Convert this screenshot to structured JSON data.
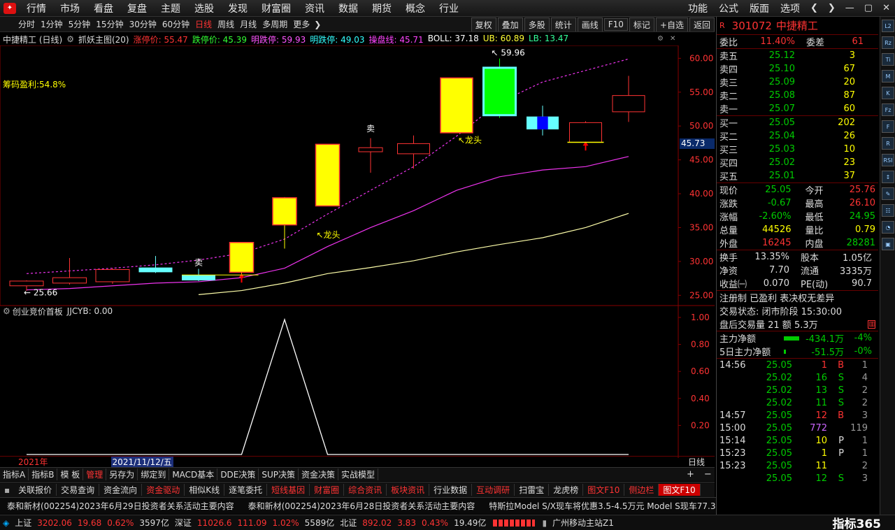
{
  "menu": {
    "left": [
      "行情",
      "市场",
      "看盘",
      "复盘",
      "主题",
      "选股",
      "发现",
      "财富圈",
      "资讯",
      "数据",
      "期货",
      "概念",
      "行业"
    ],
    "right": [
      "功能",
      "公式",
      "版面",
      "选项"
    ]
  },
  "periods": [
    "分时",
    "1分钟",
    "5分钟",
    "15分钟",
    "30分钟",
    "60分钟",
    "日线",
    "周线",
    "月线",
    "多周期",
    "更多"
  ],
  "active_period": "日线",
  "chart_tools": [
    "复权",
    "叠加",
    "多股",
    "统计",
    "画线",
    "F10",
    "标记",
    "+自选",
    "返回"
  ],
  "legend": {
    "stock": "中捷精工 (日线)",
    "indicator": "抓妖主图(20)",
    "items": [
      {
        "label": "涨停价: 55.47",
        "color": "#ff3333"
      },
      {
        "label": "跌停价: 45.39",
        "color": "#33ff33"
      },
      {
        "label": "明跌停: 59.93",
        "color": "#ff55ff"
      },
      {
        "label": "明跌停: 49.03",
        "color": "#33ffff"
      },
      {
        "label": "操盘线: 45.71",
        "color": "#ff44ff"
      },
      {
        "label": "BOLL: 37.18",
        "color": "#ffffff"
      },
      {
        "label": "UB: 60.89",
        "color": "#ffff33"
      },
      {
        "label": "LB: 13.47",
        "color": "#33ff99"
      }
    ]
  },
  "chip_profit": "筹码盈利:54.8%",
  "price_axis": [
    "60.00",
    "55.00",
    "50.00",
    "45.00",
    "40.00",
    "35.00",
    "30.00",
    "25.00"
  ],
  "price_marker": "45.73",
  "high_label": "59.96",
  "low_label": "25.66",
  "annotations": {
    "sell": "卖",
    "dragon": "龙头"
  },
  "sub_legend": {
    "name": "创业竞价首板",
    "value": "JJCYB: 0.00"
  },
  "sub_axis": [
    "1.00",
    "0.80",
    "0.60",
    "0.40",
    "0.20"
  ],
  "date_axis": {
    "year": "2021年",
    "cursor": "2021/11/12/五",
    "period": "日线"
  },
  "chart_data": [
    {
      "type": "candlestick",
      "name": "中捷精工 (日线)",
      "ylim": [
        24,
        62
      ],
      "candles": [
        {
          "o": 26.4,
          "h": 27.2,
          "l": 25.66,
          "c": 27.1,
          "color": "red"
        },
        {
          "o": 26.8,
          "h": 30.5,
          "l": 26.6,
          "c": 27.6,
          "color": "red"
        },
        {
          "o": 27.0,
          "h": 29.0,
          "l": 26.7,
          "c": 28.8,
          "color": "red"
        },
        {
          "o": 29.1,
          "h": 30.8,
          "l": 28.3,
          "c": 28.4,
          "color": "cyan"
        },
        {
          "o": 28.0,
          "h": 28.9,
          "l": 27.1,
          "c": 27.2,
          "color": "cyan"
        },
        {
          "o": 28.4,
          "h": 32.8,
          "l": 28.0,
          "c": 32.8,
          "color": "yellow"
        },
        {
          "o": 35.4,
          "h": 39.5,
          "l": 31.9,
          "c": 39.4,
          "color": "yellow"
        },
        {
          "o": 38.2,
          "h": 47.3,
          "l": 38.2,
          "c": 47.3,
          "color": "yellow"
        },
        {
          "o": 46.2,
          "h": 48.2,
          "l": 43.1,
          "c": 46.8,
          "color": "red"
        },
        {
          "o": 45.9,
          "h": 48.6,
          "l": 43.7,
          "c": 47.4,
          "color": "red"
        },
        {
          "o": 49.0,
          "h": 57.1,
          "l": 49.0,
          "c": 57.1,
          "color": "yellow"
        },
        {
          "o": 58.6,
          "h": 59.96,
          "l": 51.2,
          "c": 51.6,
          "color": "green"
        },
        {
          "o": 51.4,
          "h": 53.0,
          "l": 48.6,
          "c": 49.5,
          "color": "blue"
        },
        {
          "o": 47.6,
          "h": 50.7,
          "l": 47.6,
          "c": 50.5,
          "color": "red"
        },
        {
          "o": 52.1,
          "h": 57.4,
          "l": 50.6,
          "c": 54.5,
          "color": "red"
        }
      ],
      "upper_line": [
        28.2,
        28.6,
        29.0,
        29.5,
        30.2,
        31.2,
        33.3,
        37.0,
        40.5,
        44.0,
        48.5,
        53.5,
        56.5,
        58.2,
        59.9
      ],
      "mid_line": [
        25.8,
        26.0,
        26.4,
        26.8,
        27.0,
        27.6,
        29.0,
        32.2,
        35.0,
        37.5,
        40.5,
        42.5,
        43.5,
        44.0,
        45.5
      ],
      "lower_line": [
        null,
        null,
        null,
        null,
        25.1,
        25.7,
        26.8,
        28.2,
        29.1,
        30.1,
        31.4,
        32.5,
        33.5,
        35.0,
        37.1
      ]
    },
    {
      "type": "line",
      "name": "创业竞价首板",
      "ylim": [
        0,
        1.0
      ],
      "values": [
        0,
        0,
        0,
        0,
        0,
        0,
        1,
        0,
        0,
        0,
        0,
        0,
        0,
        0,
        0
      ]
    }
  ],
  "right_panel": {
    "code": "301072",
    "name": "中捷精工",
    "webi": {
      "label": "委比",
      "value": "11.40%",
      "label2": "委差",
      "value2": "61"
    },
    "asks": [
      {
        "l": "卖五",
        "p": "25.12",
        "v": "3"
      },
      {
        "l": "卖四",
        "p": "25.10",
        "v": "67"
      },
      {
        "l": "卖三",
        "p": "25.09",
        "v": "20"
      },
      {
        "l": "卖二",
        "p": "25.08",
        "v": "87"
      },
      {
        "l": "卖一",
        "p": "25.07",
        "v": "60"
      }
    ],
    "bids": [
      {
        "l": "买一",
        "p": "25.05",
        "v": "202"
      },
      {
        "l": "买二",
        "p": "25.04",
        "v": "26"
      },
      {
        "l": "买三",
        "p": "25.03",
        "v": "10"
      },
      {
        "l": "买四",
        "p": "25.02",
        "v": "23"
      },
      {
        "l": "买五",
        "p": "25.01",
        "v": "37"
      }
    ],
    "quote": [
      {
        "l": "现价",
        "v": "25.05",
        "c": "green",
        "l2": "今开",
        "v2": "25.76",
        "c2": "red"
      },
      {
        "l": "涨跌",
        "v": "-0.67",
        "c": "green",
        "l2": "最高",
        "v2": "26.10",
        "c2": "red"
      },
      {
        "l": "涨幅",
        "v": "-2.60%",
        "c": "green",
        "l2": "最低",
        "v2": "24.95",
        "c2": "green"
      },
      {
        "l": "总量",
        "v": "44526",
        "c": "yellow",
        "l2": "量比",
        "v2": "0.79",
        "c2": "yellow"
      },
      {
        "l": "外盘",
        "v": "16245",
        "c": "red",
        "l2": "内盘",
        "v2": "28281",
        "c2": "green"
      }
    ],
    "stats": [
      {
        "l": "换手",
        "v": "13.35%",
        "l2": "股本",
        "v2": "1.05亿"
      },
      {
        "l": "净资",
        "v": "7.70",
        "l2": "流通",
        "v2": "3335万"
      },
      {
        "l": "收益㈠",
        "v": "0.070",
        "l2": "PE(动)",
        "v2": "90.7"
      }
    ],
    "reg": "注册制 已盈利 表决权无差异",
    "trade_status": "交易状态: 闭市阶段 15:30:00",
    "after_hours": "盘后交易量 21 额 5.3万",
    "flow": [
      {
        "l": "主力净额",
        "v": "-434.1万",
        "p": "-4%"
      },
      {
        "l": "5日主力净额",
        "v": "-51.5万",
        "p": "-0%"
      }
    ],
    "ticks": [
      {
        "t": "14:56",
        "p": "25.05",
        "v": "1",
        "s": "B",
        "n": "1"
      },
      {
        "t": "",
        "p": "25.02",
        "v": "16",
        "s": "S",
        "n": "4"
      },
      {
        "t": "",
        "p": "25.02",
        "v": "13",
        "s": "S",
        "n": "2"
      },
      {
        "t": "",
        "p": "25.02",
        "v": "11",
        "s": "S",
        "n": "2"
      },
      {
        "t": "14:57",
        "p": "25.05",
        "v": "12",
        "s": "B",
        "n": "3"
      },
      {
        "t": "15:00",
        "p": "25.05",
        "v": "772",
        "s": "",
        "n": "119"
      },
      {
        "t": "15:14",
        "p": "25.05",
        "v": "10",
        "s": "P",
        "n": "1"
      },
      {
        "t": "15:23",
        "p": "25.05",
        "v": "1",
        "s": "P",
        "n": "1"
      },
      {
        "t": "15:23",
        "p": "25.05",
        "v": "11",
        "s": "",
        "n": "2"
      },
      {
        "t": "",
        "p": "25.05",
        "v": "12",
        "s": "S",
        "n": "3"
      }
    ]
  },
  "tabs": [
    "指标A",
    "指标B",
    "模 板",
    "管理",
    "另存为",
    "绑定到",
    "MACD基本",
    "DDE决策",
    "SUP决策",
    "资金决策",
    "实战模型"
  ],
  "active_tab": "管理",
  "funcs": [
    "关联报价",
    "交易查询",
    "资金流向",
    "资金驱动",
    "相似K线",
    "逐笔委托",
    "短线基因",
    "财富圈",
    "综合资讯",
    "板块资讯",
    "行业数据",
    "互动调研",
    "扫雷宝",
    "龙虎榜",
    "图文F10",
    "侧边栏",
    "图文F10"
  ],
  "news": [
    "泰和新材(002254)2023年6月29日投资者关系活动主要内容",
    "泰和新材(002254)2023年6月28日投资者关系活动主要内容",
    "特斯拉Model S/X现车将优惠3.5-4.5万元 Model S现车77.39万"
  ],
  "status": {
    "sh_label": "上证",
    "sh_val": "3202.06",
    "sh_chg": "19.68",
    "sh_pct": "0.62%",
    "sh_amt": "3597亿",
    "sz_label": "深证",
    "sz_val": "11026.6",
    "sz_chg": "111.09",
    "sz_pct": "1.02%",
    "sz_amt": "5589亿",
    "bz_label": "北证",
    "bz_val": "892.02",
    "bz_chg": "3.83",
    "bz_pct": "0.43%",
    "bz_amt": "19.49亿",
    "station": "广州移动主站Z1",
    "brand": "指标365"
  }
}
